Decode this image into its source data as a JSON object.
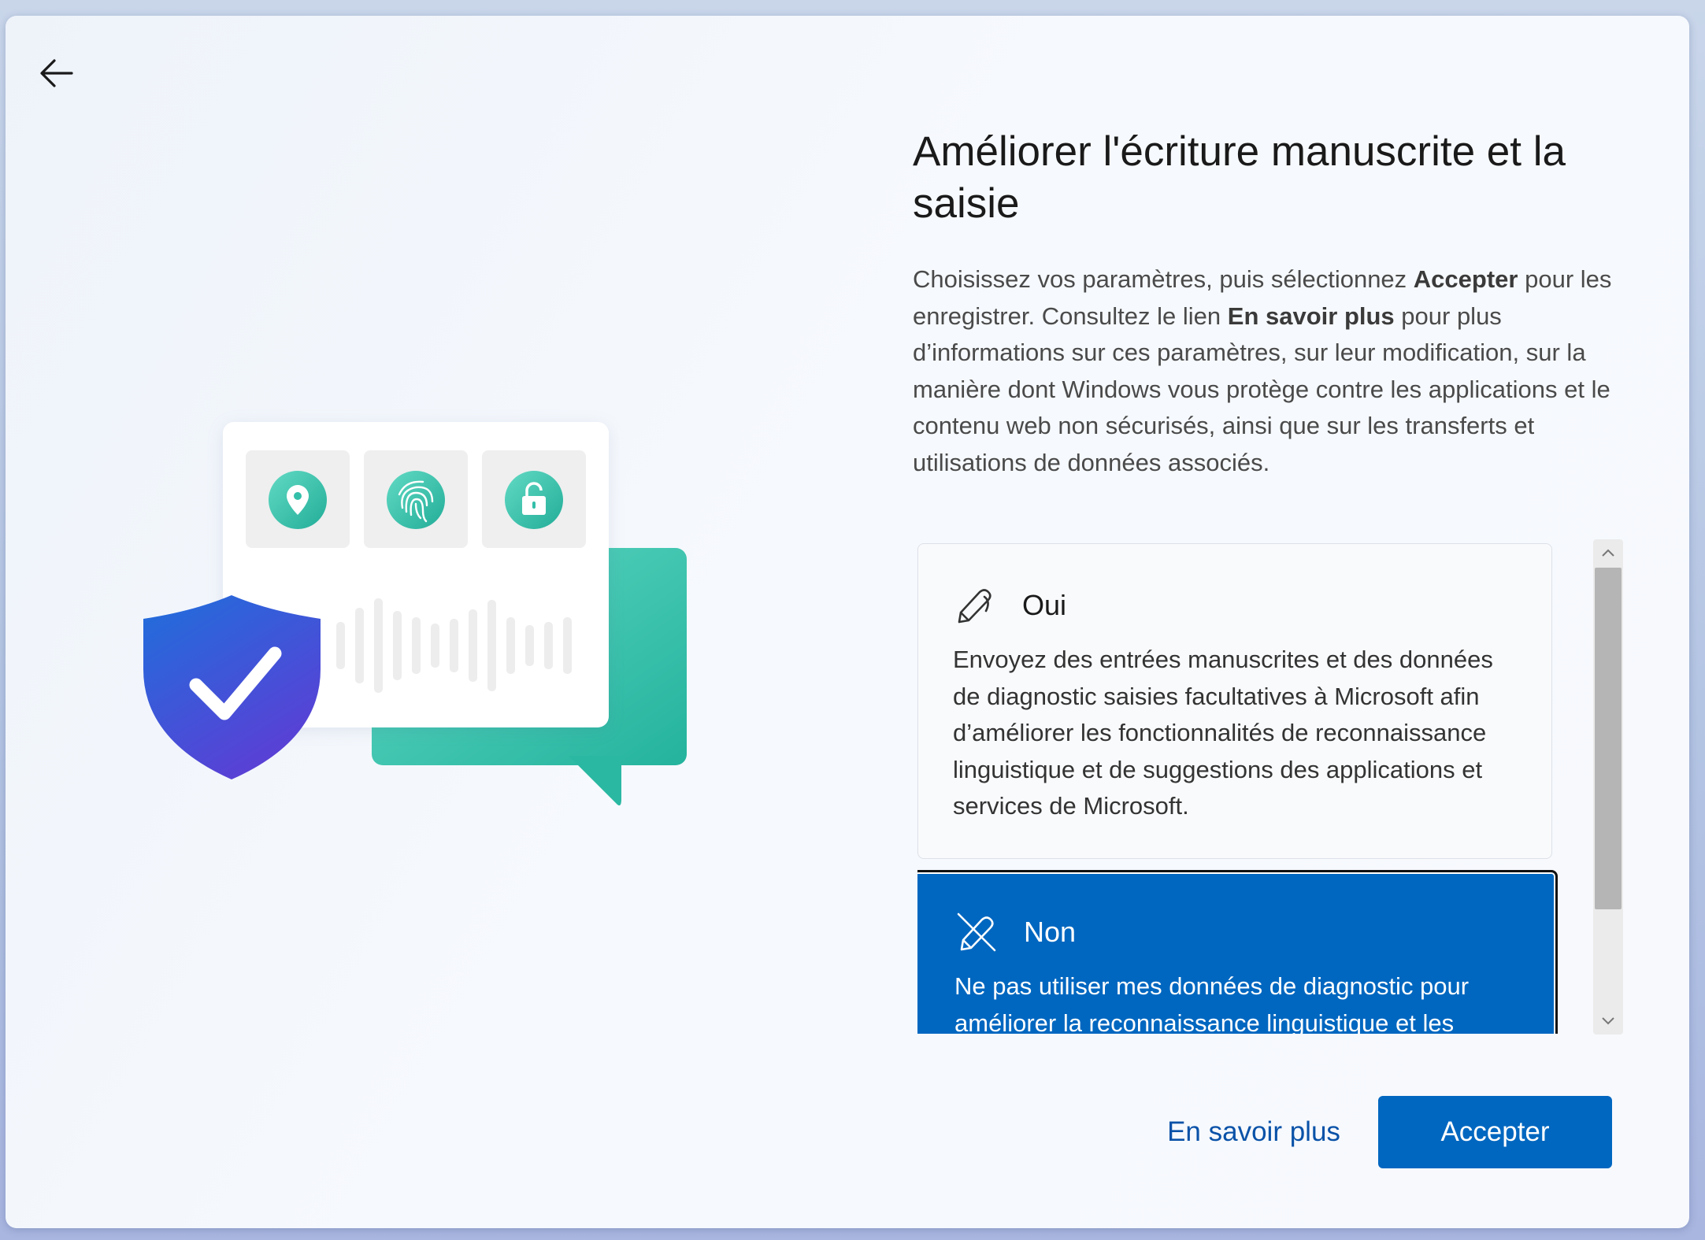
{
  "navigation": {
    "back_icon": "arrow-left-icon"
  },
  "illustration": {
    "shield_icon": "shield-check-icon",
    "card_icons": [
      "location-pin-icon",
      "fingerprint-icon",
      "unlock-icon"
    ],
    "colors": {
      "shield_top": "#1e73d9",
      "shield_bottom": "#5a3fd6",
      "teal": "#3cc7b0",
      "card": "#ffffff",
      "tile": "#f0f0f0"
    }
  },
  "page": {
    "title": "Améliorer l'écriture manuscrite et la saisie",
    "desc_1": "Choisissez vos paramètres, puis sélectionnez ",
    "desc_bold_1": "Accepter",
    "desc_2": " pour les enregistrer. Consultez le lien ",
    "desc_bold_2": "En savoir plus",
    "desc_3": " pour plus d’informations sur ces paramètres, sur leur modification, sur la manière dont Windows vous protège contre les applications et le contenu web non sécurisés, ainsi que sur les transferts et utilisations de données associés."
  },
  "options": [
    {
      "label": "Oui",
      "icon": "pen-icon",
      "description": "Envoyez des entrées manuscrites et des données de diagnostic saisies facultatives à Microsoft afin d’améliorer les fonctionnalités de reconnaissance linguistique et de suggestions des applications et services de Microsoft.",
      "selected": false
    },
    {
      "label": "Non",
      "icon": "pen-off-icon",
      "description": "Ne pas utiliser mes données de diagnostic pour améliorer la reconnaissance linguistique et les",
      "selected": true
    }
  ],
  "footer": {
    "learn_more": "En savoir plus",
    "accept": "Accepter"
  },
  "colors": {
    "accent": "#0067c0",
    "link": "#0a52a8"
  }
}
